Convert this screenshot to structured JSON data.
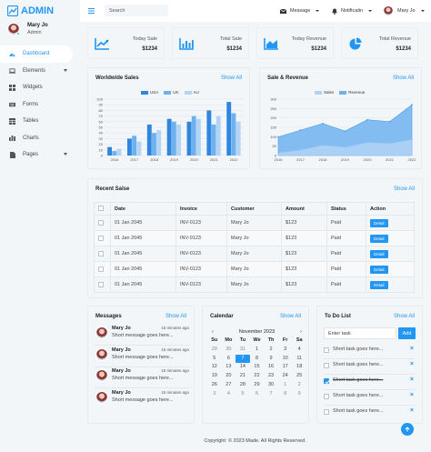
{
  "brand": {
    "name": "ADMIN"
  },
  "user": {
    "name": "Mary Jo",
    "role": "Admin"
  },
  "nav": [
    {
      "label": "Dashboard",
      "icon": "tachometer-icon",
      "active": true,
      "dropdown": false
    },
    {
      "label": "Elements",
      "icon": "laptop-icon",
      "active": false,
      "dropdown": true
    },
    {
      "label": "Widgets",
      "icon": "th-icon",
      "active": false,
      "dropdown": false
    },
    {
      "label": "Forms",
      "icon": "keyboard-icon",
      "active": false,
      "dropdown": false
    },
    {
      "label": "Tables",
      "icon": "table-icon",
      "active": false,
      "dropdown": false
    },
    {
      "label": "Charts",
      "icon": "chart-icon",
      "active": false,
      "dropdown": false
    },
    {
      "label": "Pages",
      "icon": "file-icon",
      "active": false,
      "dropdown": true
    }
  ],
  "topbar": {
    "search_placeholder": "Search",
    "message_label": "Message",
    "notification_label": "Notificatin",
    "user_name": "Mary Jo"
  },
  "stats": [
    {
      "label": "Today Sale",
      "value": "$1234",
      "icon": "line-chart-icon"
    },
    {
      "label": "Total Sale",
      "value": "$1234",
      "icon": "bar-chart-icon"
    },
    {
      "label": "Today Revenue",
      "value": "$1234",
      "icon": "area-chart-icon"
    },
    {
      "label": "Total Revenue",
      "value": "$1234",
      "icon": "pie-chart-icon"
    }
  ],
  "worldwide": {
    "title": "Worldwide Sales",
    "link": "Show All"
  },
  "salesrev": {
    "title": "Sale & Revenue",
    "link": "Show All"
  },
  "chart_data": [
    {
      "type": "bar",
      "categories": [
        "2016",
        "2017",
        "2018",
        "2019",
        "2020",
        "2021",
        "2022"
      ],
      "series": [
        {
          "name": "USA",
          "values": [
            15,
            30,
            55,
            65,
            60,
            80,
            95
          ],
          "color": "#2e86de"
        },
        {
          "name": "UK",
          "values": [
            8,
            35,
            40,
            60,
            70,
            55,
            75
          ],
          "color": "#6fb1ee"
        },
        {
          "name": "AU",
          "values": [
            12,
            25,
            45,
            55,
            65,
            70,
            60
          ],
          "color": "#b3d5f5"
        }
      ],
      "ylim": [
        0,
        100
      ],
      "yticks": [
        0,
        10,
        20,
        30,
        40,
        50,
        60,
        70,
        80,
        90,
        100
      ],
      "legend": "top-center"
    },
    {
      "type": "area",
      "categories": [
        "2016",
        "2017",
        "2018",
        "2019",
        "2020",
        "2021",
        "2022"
      ],
      "series": [
        {
          "name": "Sales",
          "values": [
            15,
            30,
            55,
            45,
            70,
            65,
            85
          ],
          "color": "#aed3f5"
        },
        {
          "name": "Revenue",
          "values": [
            99,
            135,
            170,
            130,
            190,
            180,
            270
          ],
          "color": "#6fb1ee"
        }
      ],
      "ylim": [
        0,
        300
      ],
      "yticks": [
        0,
        50,
        100,
        150,
        200,
        250,
        300
      ],
      "legend": "top-center"
    }
  ],
  "recent": {
    "title": "Recent Salse",
    "link": "Show All",
    "columns": [
      "",
      "Date",
      "Invoice",
      "Customer",
      "Amount",
      "Status",
      "Action"
    ],
    "rows": [
      {
        "date": "01 Jan 2045",
        "invoice": "INV-0123",
        "customer": "Mary Jo",
        "amount": "$123",
        "status": "Paid",
        "action": "Detail"
      },
      {
        "date": "01 Jan 2045",
        "invoice": "INV-0123",
        "customer": "Mary Jo",
        "amount": "$123",
        "status": "Paid",
        "action": "Detail"
      },
      {
        "date": "01 Jan 2045",
        "invoice": "INV-0123",
        "customer": "Mary Jo",
        "amount": "$123",
        "status": "Paid",
        "action": "Detail"
      },
      {
        "date": "01 Jan 2045",
        "invoice": "INV-0123",
        "customer": "Mary Jo",
        "amount": "$123",
        "status": "Paid",
        "action": "Detail"
      },
      {
        "date": "01 Jan 2045",
        "invoice": "INV-0123",
        "customer": "Mary Jo",
        "amount": "$123",
        "status": "Paid",
        "action": "Detail"
      }
    ]
  },
  "messages": {
    "title": "Messages",
    "link": "Show All",
    "items": [
      {
        "name": "Mary Jo",
        "time": "15 minutes ago",
        "text": "Short message goes here..."
      },
      {
        "name": "Mary Jo",
        "time": "15 minutes ago",
        "text": "Short message goes here..."
      },
      {
        "name": "Mary Jo",
        "time": "15 minutes ago",
        "text": "Short message goes here..."
      },
      {
        "name": "Mary Jo",
        "time": "15 minutes ago",
        "text": "Short message goes here..."
      }
    ]
  },
  "calendar": {
    "title": "Calendar",
    "link": "Show All",
    "month": "November 2023",
    "prev": "‹",
    "next": "›",
    "dow": [
      "Su",
      "Mo",
      "Tu",
      "We",
      "Th",
      "Fr",
      "Sa"
    ],
    "days": [
      {
        "d": "29",
        "m": true
      },
      {
        "d": "30",
        "m": true
      },
      {
        "d": "31",
        "m": true
      },
      {
        "d": "1"
      },
      {
        "d": "2"
      },
      {
        "d": "3"
      },
      {
        "d": "4"
      },
      {
        "d": "5"
      },
      {
        "d": "6"
      },
      {
        "d": "7",
        "t": true
      },
      {
        "d": "8"
      },
      {
        "d": "9"
      },
      {
        "d": "10"
      },
      {
        "d": "11"
      },
      {
        "d": "12"
      },
      {
        "d": "13"
      },
      {
        "d": "14"
      },
      {
        "d": "15"
      },
      {
        "d": "16"
      },
      {
        "d": "17"
      },
      {
        "d": "18"
      },
      {
        "d": "19"
      },
      {
        "d": "20"
      },
      {
        "d": "21"
      },
      {
        "d": "22"
      },
      {
        "d": "23"
      },
      {
        "d": "24"
      },
      {
        "d": "25"
      },
      {
        "d": "26"
      },
      {
        "d": "27"
      },
      {
        "d": "28"
      },
      {
        "d": "29"
      },
      {
        "d": "30"
      },
      {
        "d": "1",
        "m": true
      },
      {
        "d": "2",
        "m": true
      },
      {
        "d": "3",
        "m": true
      },
      {
        "d": "4",
        "m": true
      },
      {
        "d": "5",
        "m": true
      },
      {
        "d": "6",
        "m": true
      },
      {
        "d": "7",
        "m": true
      },
      {
        "d": "8",
        "m": true
      },
      {
        "d": "9",
        "m": true
      }
    ]
  },
  "todo": {
    "title": "To Do List",
    "link": "Show All",
    "placeholder": "Enter task",
    "add_label": "Add",
    "items": [
      {
        "text": "Short task goes here...",
        "done": false
      },
      {
        "text": "Short task goes here...",
        "done": false
      },
      {
        "text": "Short task goes here...",
        "done": true
      },
      {
        "text": "Short task goes here...",
        "done": false
      },
      {
        "text": "Short task goes here...",
        "done": false
      }
    ],
    "delete_glyph": "×"
  },
  "footer": {
    "copyright": "Copyright: © 2023 Made. All Rights Reserved."
  },
  "accent_color": "#2196f3"
}
